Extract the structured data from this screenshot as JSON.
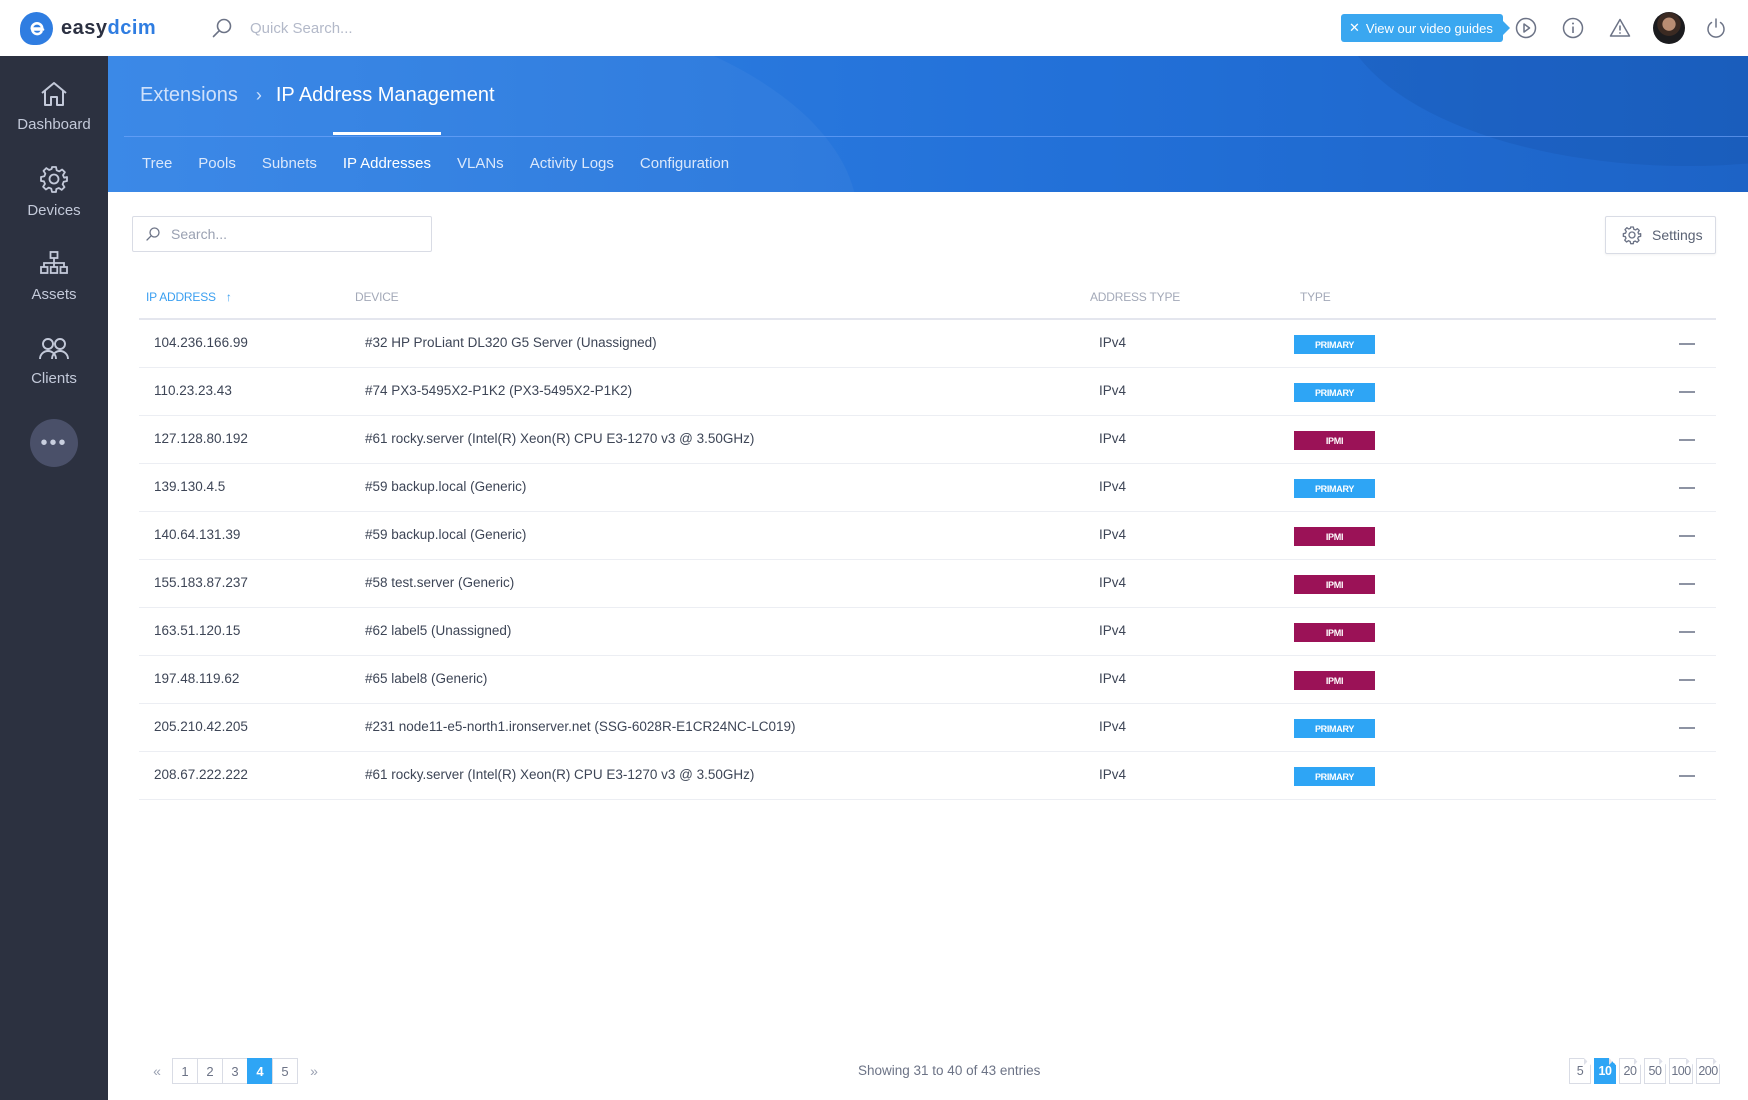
{
  "app": {
    "logo_text_a": "easy",
    "logo_text_b": "dcim",
    "quick_search_placeholder": "Quick Search..."
  },
  "topbar": {
    "video_guides_label": "View our video guides",
    "icons": [
      "play-circle-icon",
      "info-icon",
      "warning-icon",
      "avatar",
      "power-icon"
    ]
  },
  "sidebar": {
    "items": [
      {
        "label": "Dashboard",
        "icon": "home-icon"
      },
      {
        "label": "Devices",
        "icon": "gear-icon"
      },
      {
        "label": "Assets",
        "icon": "hierarchy-icon"
      },
      {
        "label": "Clients",
        "icon": "users-icon"
      }
    ],
    "more_label": "•••"
  },
  "header": {
    "breadcrumb_parent": "Extensions",
    "breadcrumb_current": "IP Address Management",
    "tabs": [
      {
        "label": "Tree",
        "active": false
      },
      {
        "label": "Pools",
        "active": false
      },
      {
        "label": "Subnets",
        "active": false
      },
      {
        "label": "IP Addresses",
        "active": true
      },
      {
        "label": "VLANs",
        "active": false
      },
      {
        "label": "Activity Logs",
        "active": false
      },
      {
        "label": "Configuration",
        "active": false
      }
    ]
  },
  "toolbar": {
    "search_placeholder": "Search...",
    "settings_label": "Settings"
  },
  "table": {
    "columns": [
      "IP Address",
      "Device",
      "Address Type",
      "Type"
    ],
    "sort_indicator": "↑",
    "rows": [
      {
        "ip": "104.236.166.99",
        "device": "#32 HP ProLiant DL320 G5 Server (Unassigned)",
        "address_type": "IPv4",
        "type": "PRIMARY"
      },
      {
        "ip": "110.23.23.43",
        "device": "#74 PX3-5495X2-P1K2 (PX3-5495X2-P1K2)",
        "address_type": "IPv4",
        "type": "PRIMARY"
      },
      {
        "ip": "127.128.80.192",
        "device": "#61 rocky.server (Intel(R) Xeon(R) CPU E3-1270 v3 @ 3.50GHz)",
        "address_type": "IPv4",
        "type": "IPMI"
      },
      {
        "ip": "139.130.4.5",
        "device": "#59 backup.local (Generic)",
        "address_type": "IPv4",
        "type": "PRIMARY"
      },
      {
        "ip": "140.64.131.39",
        "device": "#59 backup.local (Generic)",
        "address_type": "IPv4",
        "type": "IPMI"
      },
      {
        "ip": "155.183.87.237",
        "device": "#58 test.server (Generic)",
        "address_type": "IPv4",
        "type": "IPMI"
      },
      {
        "ip": "163.51.120.15",
        "device": "#62 label5 (Unassigned)",
        "address_type": "IPv4",
        "type": "IPMI"
      },
      {
        "ip": "197.48.119.62",
        "device": "#65 label8 (Generic)",
        "address_type": "IPv4",
        "type": "IPMI"
      },
      {
        "ip": "205.210.42.205",
        "device": "#231 node11-e5-north1.ironserver.net (SSG-6028R-E1CR24NC-LC019)",
        "address_type": "IPv4",
        "type": "PRIMARY"
      },
      {
        "ip": "208.67.222.222",
        "device": "#61 rocky.server (Intel(R) Xeon(R) CPU E3-1270 v3 @ 3.50GHz)",
        "address_type": "IPv4",
        "type": "PRIMARY"
      }
    ],
    "type_colors": {
      "PRIMARY": "#2ea5f5",
      "IPMI": "#9b1257"
    }
  },
  "footer": {
    "prev_label": "«",
    "next_label": "»",
    "pages": [
      "1",
      "2",
      "3",
      "4",
      "5"
    ],
    "current_page": "4",
    "showing_text": "Showing 31 to 40 of 43 entries",
    "page_sizes": [
      "5",
      "10",
      "20",
      "50",
      "100",
      "200"
    ],
    "current_page_size": "10"
  },
  "colors": {
    "accent": "#2f7de1",
    "sidebar_bg": "#2c3140",
    "active_blue": "#2ea5f5"
  }
}
